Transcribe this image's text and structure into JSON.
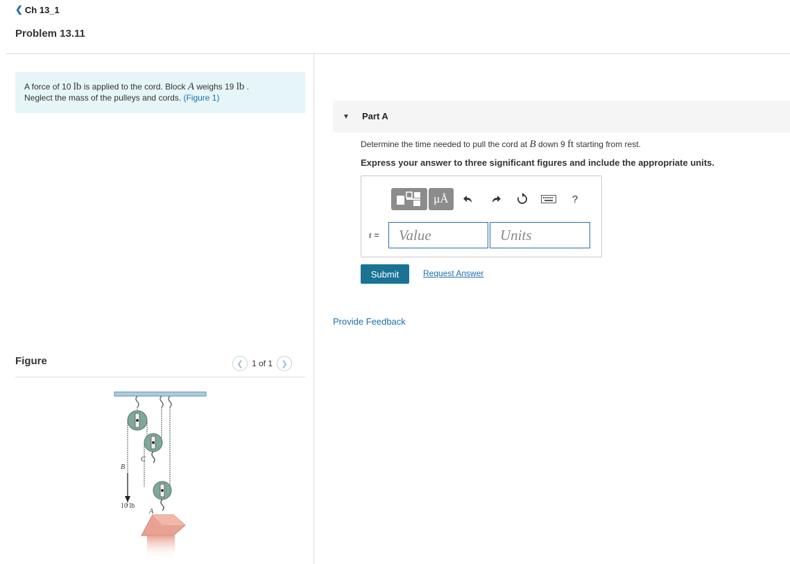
{
  "nav": {
    "back_label": "Ch 13_1"
  },
  "problem": {
    "title": "Problem 13.11",
    "statement": {
      "t1": "A force of 10 ",
      "u1": "lb",
      "t2": " is applied to the cord. Block ",
      "v1": "A",
      "t3": " weighs 19 ",
      "u2": "lb",
      "t4": " .",
      "line2": "Neglect the mass of the pulleys and cords. ",
      "figure_link": "(Figure 1)"
    }
  },
  "figure": {
    "heading": "Figure",
    "pager": "1 of 1",
    "prev_icon": "chevron-left-icon",
    "next_icon": "chevron-right-icon",
    "labels": {
      "b": "B",
      "c": "C",
      "a": "A",
      "force": "10 lb"
    }
  },
  "part": {
    "label": "Part A",
    "question": {
      "t1": "Determine the time needed to pull the cord at ",
      "v1": "B",
      "t2": " down 9 ",
      "u1": "ft",
      "t3": " starting from rest."
    },
    "instruction": "Express your answer to three significant figures and include the appropriate units.",
    "toolbar": {
      "templates_icon": "templates-icon",
      "units_symbol": "μÅ",
      "undo_icon": "undo-icon",
      "redo_icon": "redo-icon",
      "reset_icon": "reset-icon",
      "keyboard_icon": "keyboard-icon",
      "help_symbol": "?"
    },
    "answer": {
      "variable": "t",
      "equals": " =",
      "value_placeholder": "Value",
      "units_placeholder": "Units"
    },
    "submit_label": "Submit",
    "request_answer_label": "Request Answer"
  },
  "feedback_label": "Provide Feedback",
  "colors": {
    "accent": "#1a7395",
    "link": "#1b6fae",
    "statement_bg": "#e6f5f7",
    "pulley": "#7fa89a",
    "block": "#e9a291"
  }
}
